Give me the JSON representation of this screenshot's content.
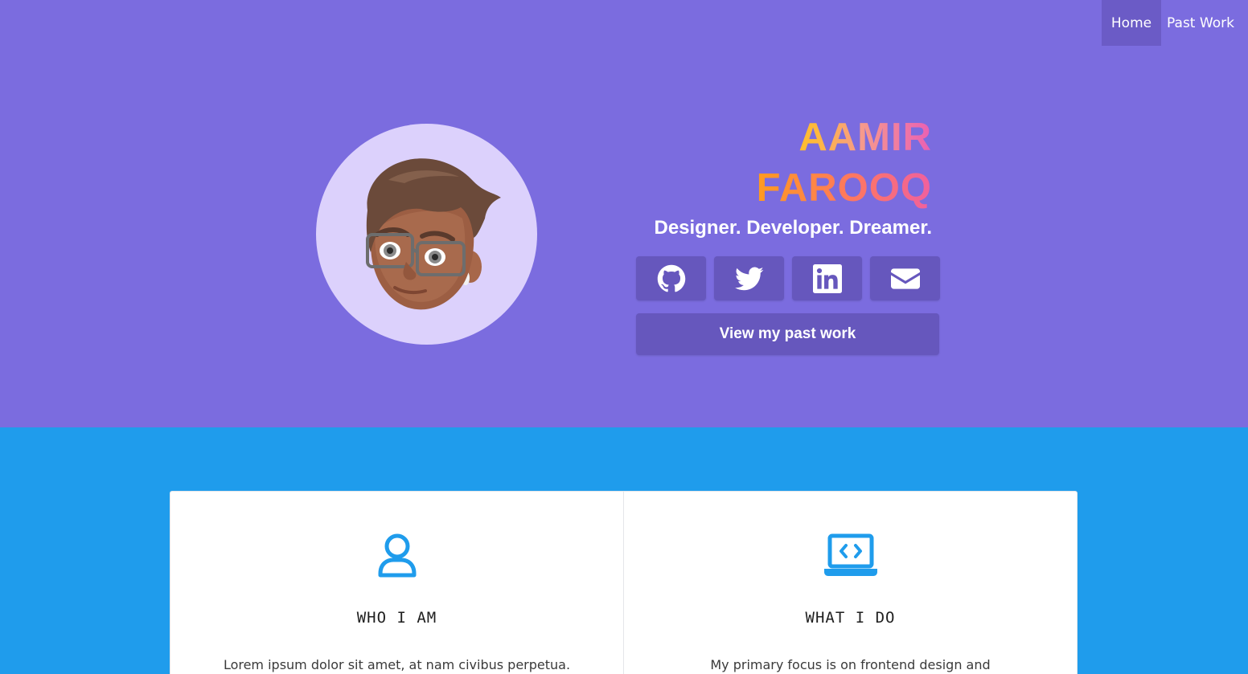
{
  "nav": {
    "items": [
      {
        "label": "Home",
        "active": true
      },
      {
        "label": "Past Work",
        "active": false
      }
    ]
  },
  "hero": {
    "avatar_alt": "memoji avatar",
    "name_line1": "AAMIR",
    "name_line2": "FAROOQ",
    "tagline": "Designer. Developer. Dreamer.",
    "socials": [
      {
        "name": "github",
        "icon": "github-icon"
      },
      {
        "name": "twitter",
        "icon": "twitter-icon"
      },
      {
        "name": "linkedin",
        "icon": "linkedin-icon"
      },
      {
        "name": "email",
        "icon": "envelope-icon"
      }
    ],
    "cta_label": "View my past work"
  },
  "cards": [
    {
      "icon": "user-icon",
      "title": "WHO I AM",
      "text": "Lorem ipsum dolor sit amet, at nam civibus perpetua."
    },
    {
      "icon": "laptop-code-icon",
      "title": "WHAT I DO",
      "text": "My primary focus is on frontend design and"
    }
  ],
  "colors": {
    "hero_bg": "#7b6cdf",
    "button_bg": "#6657bd",
    "section_bg": "#1f9cec",
    "accent_icon": "#1f9cec"
  }
}
